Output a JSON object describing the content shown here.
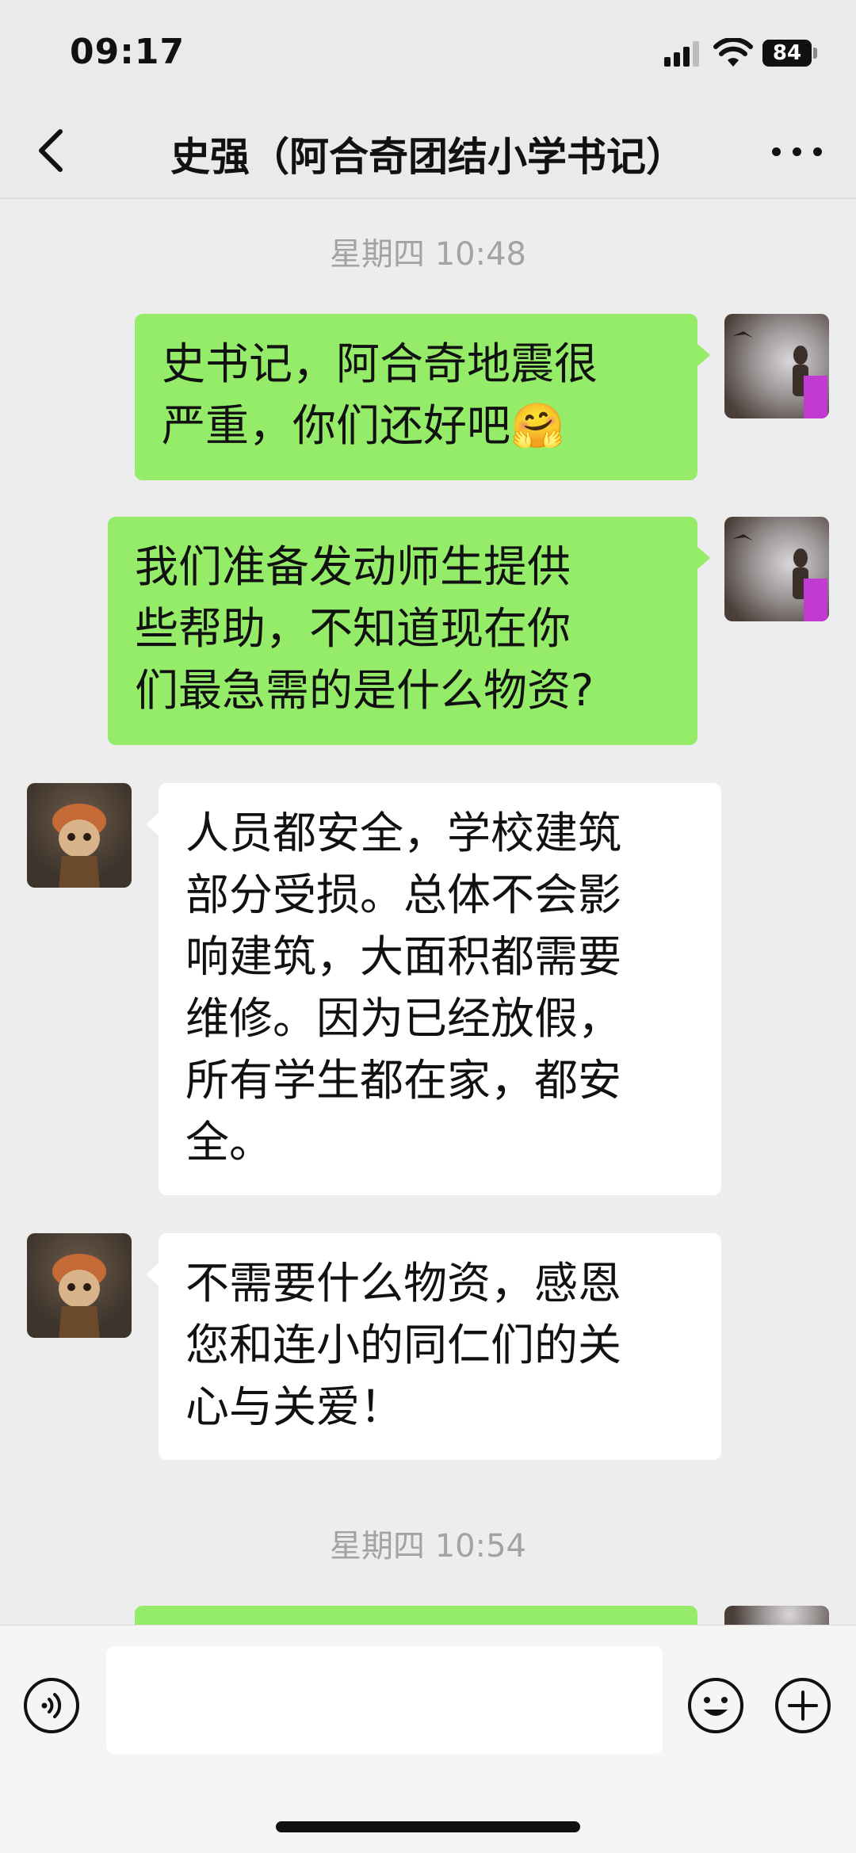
{
  "status_bar": {
    "time": "09:17",
    "battery": "84"
  },
  "header": {
    "title": "史强（阿合奇团结小学书记）",
    "back_icon": "chevron-left-icon",
    "more_icon": "more-dots-icon"
  },
  "messages": [
    {
      "type": "timestamp",
      "text": "星期四 10:48"
    },
    {
      "type": "sent",
      "lines": [
        "史书记，阿合奇地震很",
        "严重，你们还好吧🤗"
      ]
    },
    {
      "type": "sent",
      "lines": [
        "我们准备发动师生提供",
        "些帮助，不知道现在你",
        "们最急需的是什么物资?"
      ]
    },
    {
      "type": "received",
      "lines": [
        "人员都安全，学校建筑",
        "部分受损。总体不会影",
        "响建筑，大面积都需要",
        "维修。因为已经放假，",
        "所有学生都在家，都安",
        "全。"
      ]
    },
    {
      "type": "received",
      "lines": [
        "不需要什么物资，感恩",
        "您和连小的同仁们的关",
        "心与关爱！"
      ]
    },
    {
      "type": "timestamp",
      "text": "星期四 10:54"
    }
  ],
  "input_bar": {
    "placeholder": "",
    "voice_icon": "voice-icon",
    "emoji_icon": "emoji-icon",
    "plus_icon": "plus-icon"
  },
  "colors": {
    "sent_bubble": "#95ec69",
    "received_bubble": "#ffffff",
    "background": "#ededed",
    "timestamp": "#a3a3a3"
  }
}
